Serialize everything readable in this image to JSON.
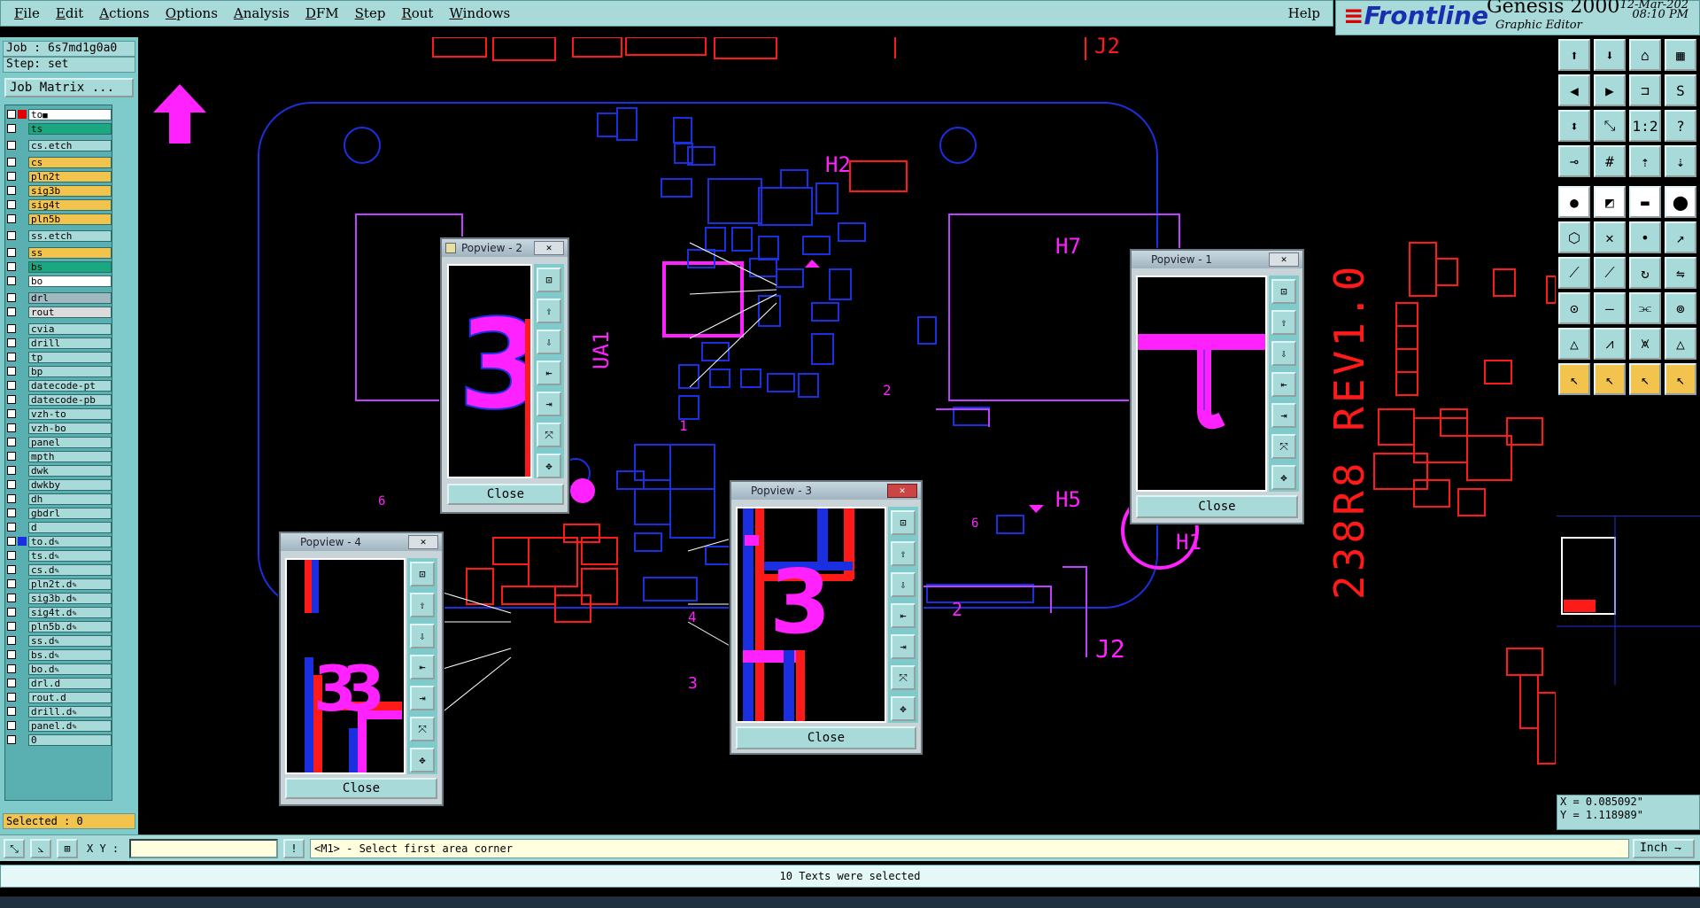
{
  "menu": [
    "File",
    "Edit",
    "Actions",
    "Options",
    "Analysis",
    "DFM",
    "Step",
    "Rout",
    "Windows"
  ],
  "help": "Help",
  "brand": {
    "logo": "Frontline",
    "product": "Genesis 2000",
    "subtitle": "Graphic Editor",
    "date": "12-Mar-202",
    "time": "08:10 PM"
  },
  "job": {
    "job_line": "Job : 6s7md1g0a0",
    "step_line": "Step: set",
    "matrix_label": "Job Matrix ..."
  },
  "layers": [
    {
      "name": "to",
      "color": "#ffffff",
      "sw": "#e00000",
      "pen": "■"
    },
    {
      "name": "ts",
      "color": "#1aa880",
      "sw": "",
      "pen": ""
    },
    {
      "name": "cs.etch",
      "color": "#a8dada",
      "sw": "",
      "pen": ""
    },
    {
      "name": "cs",
      "color": "#f3c44d",
      "sw": "",
      "pen": ""
    },
    {
      "name": "pln2t",
      "color": "#f3c44d",
      "sw": "",
      "pen": ""
    },
    {
      "name": "sig3b",
      "color": "#f3c44d",
      "sw": "",
      "pen": ""
    },
    {
      "name": "sig4t",
      "color": "#f3c44d",
      "sw": "",
      "pen": ""
    },
    {
      "name": "pln5b",
      "color": "#f3c44d",
      "sw": "",
      "pen": ""
    },
    {
      "name": "ss.etch",
      "color": "#a8dada",
      "sw": "",
      "pen": ""
    },
    {
      "name": "ss",
      "color": "#f3c44d",
      "sw": "",
      "pen": ""
    },
    {
      "name": "bs",
      "color": "#1aa880",
      "sw": "",
      "pen": ""
    },
    {
      "name": "bo",
      "color": "#ffffff",
      "sw": "",
      "pen": ""
    },
    {
      "name": "drl",
      "color": "#a0b8c0",
      "sw": "",
      "pen": ""
    },
    {
      "name": "rout",
      "color": "#dcdcdc",
      "sw": "",
      "pen": ""
    },
    {
      "name": "cvia",
      "color": "#a8dada",
      "sw": "",
      "pen": ""
    },
    {
      "name": "drill",
      "color": "#a8dada",
      "sw": "",
      "pen": ""
    },
    {
      "name": "tp",
      "color": "#a8dada",
      "sw": "",
      "pen": ""
    },
    {
      "name": "bp",
      "color": "#a8dada",
      "sw": "",
      "pen": ""
    },
    {
      "name": "datecode-pt",
      "color": "#a8dada",
      "sw": "",
      "pen": ""
    },
    {
      "name": "datecode-pb",
      "color": "#a8dada",
      "sw": "",
      "pen": ""
    },
    {
      "name": "vzh-to",
      "color": "#a8dada",
      "sw": "",
      "pen": ""
    },
    {
      "name": "vzh-bo",
      "color": "#a8dada",
      "sw": "",
      "pen": ""
    },
    {
      "name": "panel",
      "color": "#a8dada",
      "sw": "",
      "pen": ""
    },
    {
      "name": "mpth",
      "color": "#a8dada",
      "sw": "",
      "pen": ""
    },
    {
      "name": "dwk",
      "color": "#a8dada",
      "sw": "",
      "pen": ""
    },
    {
      "name": "dwkby",
      "color": "#a8dada",
      "sw": "",
      "pen": ""
    },
    {
      "name": "dh",
      "color": "#a8dada",
      "sw": "",
      "pen": ""
    },
    {
      "name": "gbdrl",
      "color": "#a8dada",
      "sw": "",
      "pen": ""
    },
    {
      "name": "d",
      "color": "#a8dada",
      "sw": "",
      "pen": ""
    },
    {
      "name": "to.d",
      "color": "#a8dada",
      "sw": "#1a2fe0",
      "pen": "✎"
    },
    {
      "name": "ts.d",
      "color": "#a8dada",
      "sw": "",
      "pen": "✎"
    },
    {
      "name": "cs.d",
      "color": "#a8dada",
      "sw": "",
      "pen": "✎"
    },
    {
      "name": "pln2t.d",
      "color": "#a8dada",
      "sw": "",
      "pen": "✎"
    },
    {
      "name": "sig3b.d",
      "color": "#a8dada",
      "sw": "",
      "pen": "✎"
    },
    {
      "name": "sig4t.d",
      "color": "#a8dada",
      "sw": "",
      "pen": "✎"
    },
    {
      "name": "pln5b.d",
      "color": "#a8dada",
      "sw": "",
      "pen": "✎"
    },
    {
      "name": "ss.d",
      "color": "#a8dada",
      "sw": "",
      "pen": "✎"
    },
    {
      "name": "bs.d",
      "color": "#a8dada",
      "sw": "",
      "pen": "✎"
    },
    {
      "name": "bo.d",
      "color": "#a8dada",
      "sw": "",
      "pen": "✎"
    },
    {
      "name": "drl.d",
      "color": "#a8dada",
      "sw": "",
      "pen": ""
    },
    {
      "name": "rout.d",
      "color": "#a8dada",
      "sw": "",
      "pen": ""
    },
    {
      "name": "drill.d",
      "color": "#a8dada",
      "sw": "",
      "pen": "✎"
    },
    {
      "name": "panel.d",
      "color": "#a8dada",
      "sw": "",
      "pen": "✎"
    },
    {
      "name": "0",
      "color": "#a8dada",
      "sw": "",
      "pen": ""
    }
  ],
  "selected": "Selected : 0",
  "board_labels": {
    "j2_top": "J2",
    "j2_bottom": "J2",
    "h2": "H2",
    "h7": "H7",
    "h5": "H5",
    "h1": "H1",
    "ua1": "UA1",
    "rev": "238R8 REV1.0",
    "n2a": "2",
    "n2b": "2",
    "n1": "1",
    "n3": "3",
    "n4": "4",
    "n6a": "6",
    "n6b": "6"
  },
  "popviews": [
    {
      "title": "Popview - 1",
      "close": "Close"
    },
    {
      "title": "Popview - 2",
      "close": "Close"
    },
    {
      "title": "Popview - 3",
      "close": "Close"
    },
    {
      "title": "Popview - 4",
      "close": "Close"
    }
  ],
  "coords": {
    "x": "X = 0.085092\"",
    "y": "Y = 1.118989\""
  },
  "prompt": {
    "xy_label": "X Y :",
    "xy_value": "",
    "message": "<M1> - Select first area corner",
    "unit": "Inch"
  },
  "status": "10 Texts were selected",
  "colors": {
    "panel": "#a8dada",
    "board_outline": "#1a2fe0",
    "magenta": "#ff22ff",
    "red": "#ff1a1a"
  }
}
